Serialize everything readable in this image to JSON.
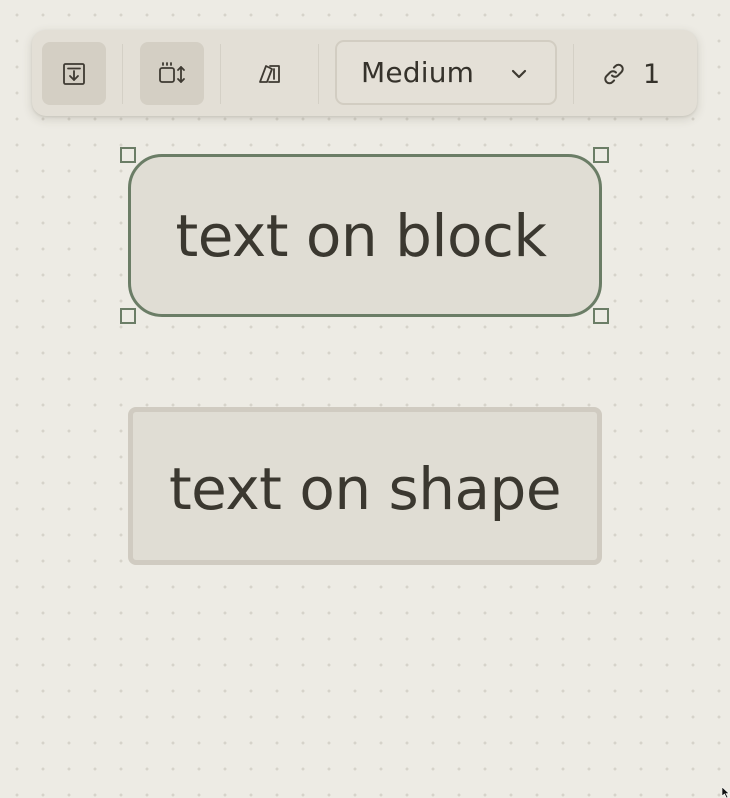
{
  "toolbar": {
    "buttons": [
      {
        "icon": "insert-to-canvas-icon",
        "active": true
      },
      {
        "icon": "auto-height-icon",
        "active": true
      },
      {
        "icon": "color-style-icon",
        "active": false
      }
    ],
    "size_dropdown": {
      "selected": "Medium",
      "icon": "chevron-down-icon"
    },
    "links": {
      "icon": "link-icon",
      "count": "1"
    }
  },
  "canvas": {
    "block_text": "text on block",
    "shape_text": "text on shape",
    "selected_element": "block"
  },
  "colors": {
    "background": "#edebe4",
    "toolbar": "#e3dfd6",
    "selection": "#6b7d66",
    "block_fill": "#e0ddd4",
    "shape_border": "#d0cbc1",
    "text": "#3b3830"
  }
}
